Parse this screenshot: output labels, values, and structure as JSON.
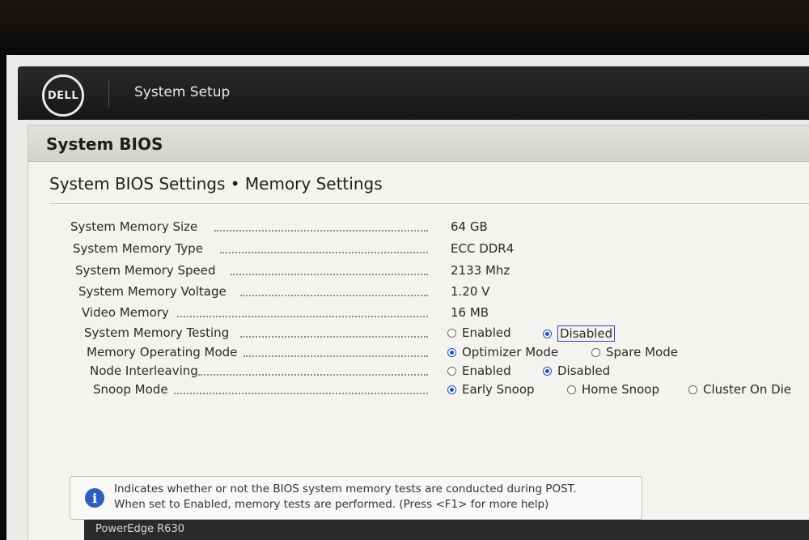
{
  "header": {
    "logo_text": "DELL",
    "title": "System Setup"
  },
  "panel": {
    "title": "System BIOS",
    "section_title": "System BIOS Settings • Memory Settings"
  },
  "settings": [
    {
      "label": "System Memory Size",
      "value": "64 GB"
    },
    {
      "label": "System Memory Type",
      "value": "ECC DDR4"
    },
    {
      "label": "System Memory Speed",
      "value": "2133 Mhz"
    },
    {
      "label": "System Memory Voltage",
      "value": "1.20 V"
    },
    {
      "label": "Video Memory",
      "value": "16 MB"
    },
    {
      "label": "System Memory Testing",
      "options": [
        "Enabled",
        "Disabled"
      ],
      "selected": "Disabled"
    },
    {
      "label": "Memory Operating Mode",
      "options": [
        "Optimizer Mode",
        "Spare Mode"
      ],
      "selected": "Optimizer Mode"
    },
    {
      "label": "Node Interleaving",
      "options": [
        "Enabled",
        "Disabled"
      ],
      "selected": "Disabled"
    },
    {
      "label": "Snoop Mode",
      "options": [
        "Early Snoop",
        "Home Snoop",
        "Cluster On Die"
      ],
      "selected": "Early Snoop"
    }
  ],
  "help": {
    "icon": "info-icon",
    "line1": "Indicates whether or not the BIOS system memory tests are conducted during POST.",
    "line2": "When set to Enabled, memory tests are performed. (Press <F1> for more help)"
  },
  "footer": {
    "model": "PowerEdge R630"
  },
  "colors": {
    "header_bg": "#1e1e1f",
    "accent": "#1f4fb5",
    "panel_bg": "#f4f3f0"
  }
}
